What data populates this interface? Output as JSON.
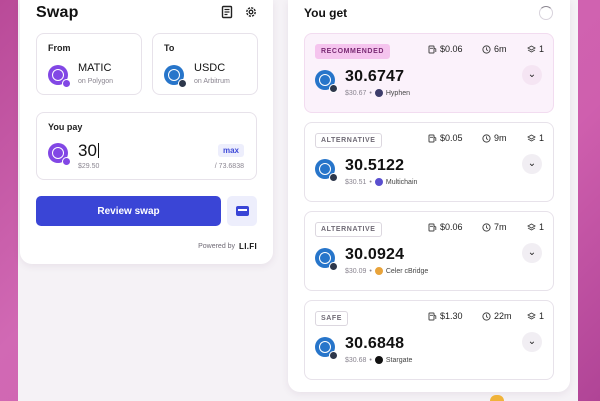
{
  "swap": {
    "title": "Swap",
    "history_icon": "receipt-icon",
    "settings_icon": "gear-icon",
    "from": {
      "label": "From",
      "token": "MATIC",
      "chain": "on Polygon"
    },
    "to": {
      "label": "To",
      "token": "USDC",
      "chain": "on Arbitrum"
    },
    "swap_icon": "swap-arrows-icon",
    "pay": {
      "label": "You pay",
      "amount": "30",
      "max_label": "max",
      "usd": "$29.50",
      "balance": "/ 73.6838"
    },
    "review_label": "Review swap",
    "powered_by": "Powered by",
    "brand": "LI.FI"
  },
  "routes": {
    "title": "You get",
    "items": [
      {
        "tag": "RECOMMENDED",
        "gas": "$0.06",
        "time": "6m",
        "steps": "1",
        "amount": "30.6747",
        "usd": "$30.67",
        "bridge": "Hyphen",
        "bridge_color": "#3d3d6b"
      },
      {
        "tag": "ALTERNATIVE",
        "gas": "$0.05",
        "time": "9m",
        "steps": "1",
        "amount": "30.5122",
        "usd": "$30.51",
        "bridge": "Multichain",
        "bridge_color": "#5a4fcf"
      },
      {
        "tag": "ALTERNATIVE",
        "gas": "$0.06",
        "time": "7m",
        "steps": "1",
        "amount": "30.0924",
        "usd": "$30.09",
        "bridge": "Celer cBridge",
        "bridge_color": "#e8a33a"
      },
      {
        "tag": "SAFE",
        "gas": "$1.30",
        "time": "22m",
        "steps": "1",
        "amount": "30.6848",
        "usd": "$30.68",
        "bridge": "Stargate",
        "bridge_color": "#111111"
      }
    ]
  },
  "colors": {
    "accent": "#3a45d6",
    "matic": "#8247e5",
    "usdc": "#2775ca",
    "recommended": "#f5c4ee"
  }
}
